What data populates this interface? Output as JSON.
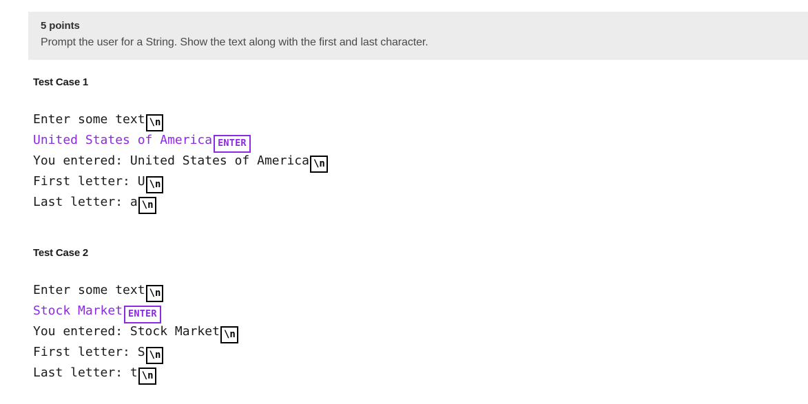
{
  "banner": {
    "points_label": "5 points",
    "description": "Prompt the user for a String. Show the text along with the first and last character.",
    "background_color": "#ececec"
  },
  "colors": {
    "input_purple": "#8a2be2",
    "output_black": "#1a1a1a",
    "page_background": "#ffffff"
  },
  "badges": {
    "newline_label": "\\n",
    "enter_label": "ENTER"
  },
  "test_cases": [
    {
      "title": "Test Case 1",
      "lines": [
        {
          "text": "Enter some text",
          "kind": "output",
          "badge": "newline"
        },
        {
          "text": "United States of America",
          "kind": "input",
          "badge": "enter"
        },
        {
          "text": "You entered: United States of America",
          "kind": "output",
          "badge": "newline"
        },
        {
          "text": "First letter: U",
          "kind": "output",
          "badge": "newline"
        },
        {
          "text": "Last letter: a",
          "kind": "output",
          "badge": "newline"
        }
      ]
    },
    {
      "title": "Test Case 2",
      "lines": [
        {
          "text": "Enter some text",
          "kind": "output",
          "badge": "newline"
        },
        {
          "text": "Stock Market",
          "kind": "input",
          "badge": "enter"
        },
        {
          "text": "You entered: Stock Market",
          "kind": "output",
          "badge": "newline"
        },
        {
          "text": "First letter: S",
          "kind": "output",
          "badge": "newline"
        },
        {
          "text": "Last letter: t",
          "kind": "output",
          "badge": "newline"
        }
      ]
    }
  ]
}
